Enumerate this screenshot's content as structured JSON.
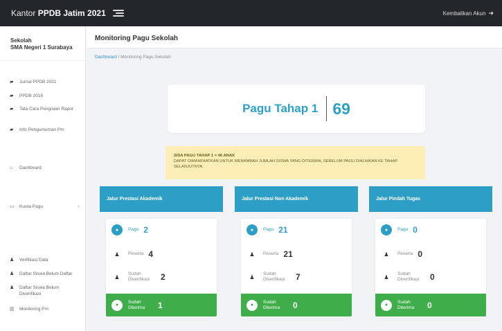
{
  "topbar": {
    "brand_prefix": "Kantor",
    "brand_bold": "PPDB Jatim 2021",
    "logout_label": "Kembalikan Akun"
  },
  "sidebar": {
    "school_label": "Sekolah",
    "school_name": "SMA Negeri 1 Surabaya",
    "group1_items": [
      "Jurnal PPDB 2021",
      "PPDB 2018",
      "Tata Cara Pengisian Rapor",
      "Info Pengumuman Pm"
    ],
    "dashboard": "Dashboard",
    "pagu_menu": "Kuota Pagu",
    "group4_items": [
      "Verifikasi Data",
      "Daftar Siswa Belum Daftar",
      "Daftar Siswa Belum Diverifikasi",
      "Monitoring Pm"
    ]
  },
  "page": {
    "title": "Monitoring Pagu Sekolah",
    "breadcrumb_root": "Dashboard",
    "breadcrumb_sep": "/",
    "breadcrumb_current": "Monitoring Pagu Sekolah"
  },
  "pagu": {
    "label": "Pagu Tahap 1",
    "value": "69"
  },
  "alert": {
    "title": "SISA PAGU TAHAP 1 = 46 ANAK",
    "body": "DAPAT DIMANFAATKAN UNTUK MENAMBAH JUMLAH SISWA YANG DITERIMA, SEBELUM PAGU DIALIHKAN KE TAHAP SELANJUTNYA."
  },
  "labels": {
    "pagu": "Pagu",
    "peserta": "Peserta",
    "diverifikasi": "Sudah Diverifikasi",
    "diterima": "Sudah Diterima"
  },
  "jalur": [
    {
      "title": "Jalur Prestasi Akademik",
      "pagu": "2",
      "peserta": "4",
      "diverifikasi": "2",
      "diterima": "1"
    },
    {
      "title": "Jalur Prestasi Non Akademik",
      "pagu": "21",
      "peserta": "21",
      "diverifikasi": "7",
      "diterima": "0"
    },
    {
      "title": "Jalur Pindah Tugas",
      "pagu": "0",
      "peserta": "0",
      "diverifikasi": "0",
      "diterima": "0"
    }
  ],
  "colors": {
    "primary": "#2d9fc6",
    "success": "#3fae4a",
    "topbar": "#23262b",
    "alert_bg": "#fdeeb5"
  }
}
